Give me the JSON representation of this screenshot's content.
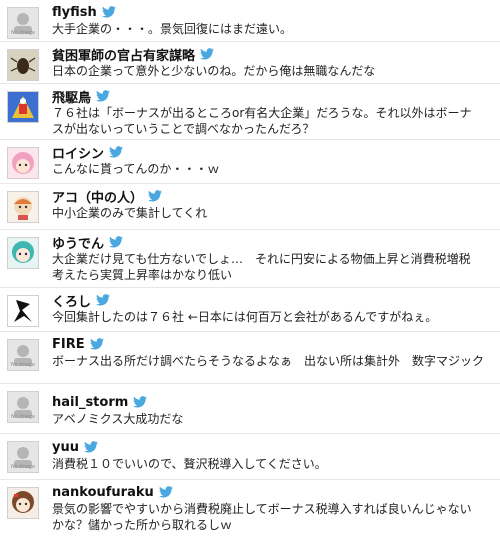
{
  "noimage_label": "No Image",
  "tweets": [
    {
      "name": "flyfish",
      "avatar": "no-image",
      "text": "大手企業の・・・。景気回復にはまだ遠い。"
    },
    {
      "name": "貧困軍師の官占有家謀略",
      "avatar": "insect",
      "text": "日本の企業って意外と少ないのね。だから俺は無職なんだな"
    },
    {
      "name": "飛駆鳥",
      "avatar": "robot-art",
      "text": "７６社は「ボーナスが出るところor有名大企業」だろうな。それ以外はボーナ\nスが出ないっていうことで調べなかったんだろ？"
    },
    {
      "name": "ロイシン",
      "avatar": "pink-hair-girl",
      "text": "こんなに貰ってんのか・・・ｗ"
    },
    {
      "name": "アコ（中の人）",
      "avatar": "chibi-character",
      "text": "中小企業のみで集計してくれ"
    },
    {
      "name": "ゆうでん",
      "avatar": "teal-hair-girl",
      "text": "大企業だけ見ても仕方ないでしょ…　それに円安による物価上昇と消費税増税\n考えたら実質上昇率はかなり低い"
    },
    {
      "name": "くろし",
      "avatar": "black-figure",
      "text": "今回集計したのは７６社 ←日本には何百万と会社があるんですがねぇ。"
    },
    {
      "name": "FIRE",
      "avatar": "no-image",
      "text": "ボーナス出る所だけ調べたらそうなるよなぁ　出ない所は集計外　数字マジック"
    },
    {
      "name": "hail_storm",
      "avatar": "no-image",
      "text": "アベノミクス大成功だな"
    },
    {
      "name": "yuu",
      "avatar": "no-image",
      "text": "消費税１０でいいので、贅沢税導入してください。"
    },
    {
      "name": "nankoufuraku",
      "avatar": "brown-hair-girl",
      "text": "景気の影響でやすいから消費税廃止してボーナス税導入すれば良いんじゃない\nかな？儲かった所から取れるしｗ"
    }
  ]
}
